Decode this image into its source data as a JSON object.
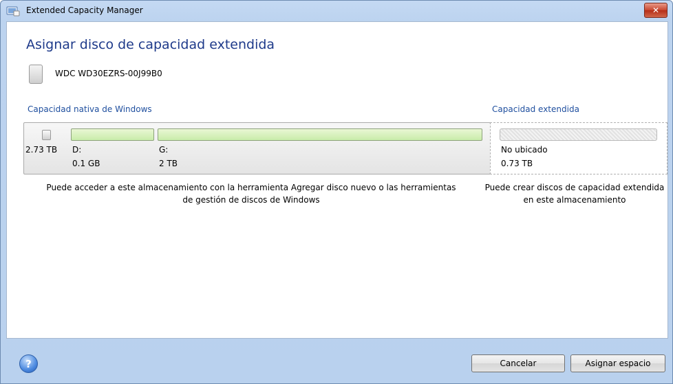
{
  "window": {
    "title": "Extended Capacity Manager",
    "close_glyph": "✕"
  },
  "page": {
    "title": "Asignar disco de capacidad extendida"
  },
  "disk": {
    "name": "WDC WD30EZRS-00J99B0"
  },
  "native": {
    "label": "Capacidad nativa de Windows",
    "total": "2.73 TB",
    "partitions": [
      {
        "letter": "D:",
        "size": "0.1 GB"
      },
      {
        "letter": "G:",
        "size": "2 TB"
      }
    ],
    "description": "Puede acceder a este almacenamiento con la herramienta Agregar disco nuevo o las herramientas de gestión de discos de Windows"
  },
  "extended": {
    "label": "Capacidad extendida",
    "status": "No ubicado",
    "size": "0.73 TB",
    "description": "Puede crear discos de capacidad extendida en este almacenamiento"
  },
  "footer": {
    "help_glyph": "?",
    "cancel_label": "Cancelar",
    "assign_label": "Asignar espacio"
  },
  "colors": {
    "title_blue": "#1e3a8a",
    "section_label_blue": "#1e4e9e",
    "partition_green": "#c8ecaa",
    "close_red": "#c7462f"
  },
  "icons": [
    "app-icon",
    "close-icon",
    "hard-disk-icon",
    "help-icon"
  ]
}
